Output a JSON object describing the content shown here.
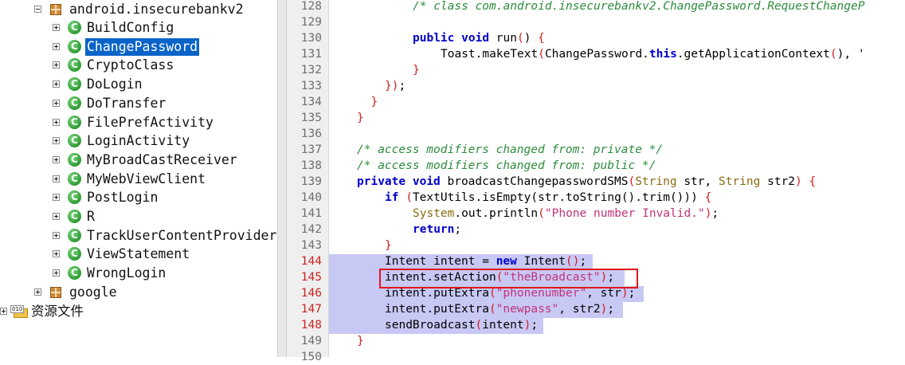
{
  "tree": {
    "package": "android.insecurebankv2",
    "classes": [
      {
        "label": "BuildConfig"
      },
      {
        "label": "ChangePassword",
        "selected": true
      },
      {
        "label": "CryptoClass"
      },
      {
        "label": "DoLogin"
      },
      {
        "label": "DoTransfer"
      },
      {
        "label": "FilePrefActivity"
      },
      {
        "label": "LoginActivity"
      },
      {
        "label": "MyBroadCastReceiver"
      },
      {
        "label": "MyWebViewClient"
      },
      {
        "label": "PostLogin"
      },
      {
        "label": "R"
      },
      {
        "label": "TrackUserContentProvider"
      },
      {
        "label": "ViewStatement"
      },
      {
        "label": "WrongLogin"
      }
    ],
    "google_package": "google",
    "resources": "资源文件",
    "class_icon_letter": "C"
  },
  "editor": {
    "highlight_color": "#c8c8f5",
    "callout_color": "#e01818",
    "lines": [
      {
        "n": "128",
        "indent": 8,
        "tokens": [
          {
            "t": "/* class com.android.insecurebankv2.ChangePassword.RequestChangeP",
            "c": "cm"
          }
        ]
      },
      {
        "n": "129",
        "indent": 0,
        "tokens": []
      },
      {
        "n": "130",
        "indent": 8,
        "tokens": [
          {
            "t": "public",
            "c": "kw"
          },
          {
            "t": " "
          },
          {
            "t": "void",
            "c": "kw"
          },
          {
            "t": " run"
          },
          {
            "t": "(",
            "c": "pn"
          },
          {
            "t": ") "
          },
          {
            "t": "{",
            "c": "pn"
          }
        ]
      },
      {
        "n": "131",
        "indent": 12,
        "tokens": [
          {
            "t": "Toast.makeText"
          },
          {
            "t": "(",
            "c": "pn"
          },
          {
            "t": "ChangePassword."
          },
          {
            "t": "this",
            "c": "kw"
          },
          {
            "t": ".getApplicationContext"
          },
          {
            "t": "(",
            "c": "pn"
          },
          {
            "t": ")"
          },
          {
            "t": ", '"
          }
        ]
      },
      {
        "n": "132",
        "indent": 8,
        "tokens": [
          {
            "t": "}",
            "c": "pn"
          }
        ]
      },
      {
        "n": "133",
        "indent": 4,
        "tokens": [
          {
            "t": "}",
            "c": "pn"
          },
          {
            "t": ")",
            "c": "pn"
          },
          {
            "t": ";"
          }
        ]
      },
      {
        "n": "134",
        "indent": 2,
        "tokens": [
          {
            "t": "}",
            "c": "pn"
          }
        ]
      },
      {
        "n": "135",
        "indent": 0,
        "tokens": [
          {
            "t": "}",
            "c": "pn"
          }
        ]
      },
      {
        "n": "136",
        "indent": 0,
        "tokens": []
      },
      {
        "n": "137",
        "indent": 0,
        "tokens": [
          {
            "t": "/* access modifiers changed from: private */",
            "c": "cm"
          }
        ]
      },
      {
        "n": "138",
        "indent": 0,
        "tokens": [
          {
            "t": "/* access modifiers changed from: public */",
            "c": "cm"
          }
        ]
      },
      {
        "n": "139",
        "indent": 0,
        "tokens": [
          {
            "t": "private",
            "c": "kw"
          },
          {
            "t": " "
          },
          {
            "t": "void",
            "c": "kw"
          },
          {
            "t": " broadcastChangepasswordSMS"
          },
          {
            "t": "(",
            "c": "pn"
          },
          {
            "t": "String",
            "c": "ty"
          },
          {
            "t": " str, "
          },
          {
            "t": "String",
            "c": "ty"
          },
          {
            "t": " str2"
          },
          {
            "t": ")",
            "c": "pn"
          },
          {
            "t": " "
          },
          {
            "t": "{",
            "c": "pn"
          }
        ]
      },
      {
        "n": "140",
        "indent": 4,
        "tokens": [
          {
            "t": "if",
            "c": "kw"
          },
          {
            "t": " "
          },
          {
            "t": "(",
            "c": "pn"
          },
          {
            "t": "TextUtils.isEmpty(str.toString().trim()))"
          },
          {
            "t": " "
          },
          {
            "t": "{",
            "c": "pn"
          }
        ]
      },
      {
        "n": "141",
        "indent": 8,
        "tokens": [
          {
            "t": "System",
            "c": "ty"
          },
          {
            "t": ".out.println"
          },
          {
            "t": "(",
            "c": "pn"
          },
          {
            "t": "\"Phone number Invalid.\"",
            "c": "st"
          },
          {
            "t": ")",
            "c": "pn"
          },
          {
            "t": ";"
          }
        ]
      },
      {
        "n": "142",
        "indent": 8,
        "tokens": [
          {
            "t": "return",
            "c": "kw"
          },
          {
            "t": ";"
          }
        ]
      },
      {
        "n": "143",
        "indent": 4,
        "tokens": [
          {
            "t": "}",
            "c": "pn"
          }
        ]
      },
      {
        "n": "144",
        "indent": 4,
        "hl": true,
        "hlw": 331,
        "tokens": [
          {
            "t": "Intent intent = "
          },
          {
            "t": "new",
            "c": "kw"
          },
          {
            "t": " Intent"
          },
          {
            "t": "(",
            "c": "pn"
          },
          {
            "t": ")",
            "c": "pn"
          },
          {
            "t": ";"
          }
        ]
      },
      {
        "n": "145",
        "indent": 4,
        "hl": true,
        "hlw": 371,
        "tokens": [
          {
            "t": "intent.setAction"
          },
          {
            "t": "(",
            "c": "pn"
          },
          {
            "t": "\"theBroadcast\"",
            "c": "st"
          },
          {
            "t": ")",
            "c": "pn"
          },
          {
            "t": ";"
          }
        ]
      },
      {
        "n": "146",
        "indent": 4,
        "hl": true,
        "hlw": 395,
        "tokens": [
          {
            "t": "intent.putExtra"
          },
          {
            "t": "(",
            "c": "pn"
          },
          {
            "t": "\"phonenumber\"",
            "c": "st"
          },
          {
            "t": ", str"
          },
          {
            "t": ")",
            "c": "pn"
          },
          {
            "t": ";"
          }
        ]
      },
      {
        "n": "147",
        "indent": 4,
        "hl": true,
        "hlw": 369,
        "tokens": [
          {
            "t": "intent.putExtra"
          },
          {
            "t": "(",
            "c": "pn"
          },
          {
            "t": "\"newpass\"",
            "c": "st"
          },
          {
            "t": ", str2"
          },
          {
            "t": ")",
            "c": "pn"
          },
          {
            "t": ";"
          }
        ]
      },
      {
        "n": "148",
        "indent": 4,
        "hl": true,
        "hlw": 269,
        "tokens": [
          {
            "t": "sendBroadcast"
          },
          {
            "t": "(",
            "c": "pn"
          },
          {
            "t": "intent"
          },
          {
            "t": ")",
            "c": "pn"
          },
          {
            "t": ";"
          }
        ]
      },
      {
        "n": "149",
        "indent": 0,
        "tokens": [
          {
            "t": "}",
            "c": "pn"
          }
        ]
      },
      {
        "n": "150",
        "indent": 0,
        "tokens": []
      }
    ]
  }
}
